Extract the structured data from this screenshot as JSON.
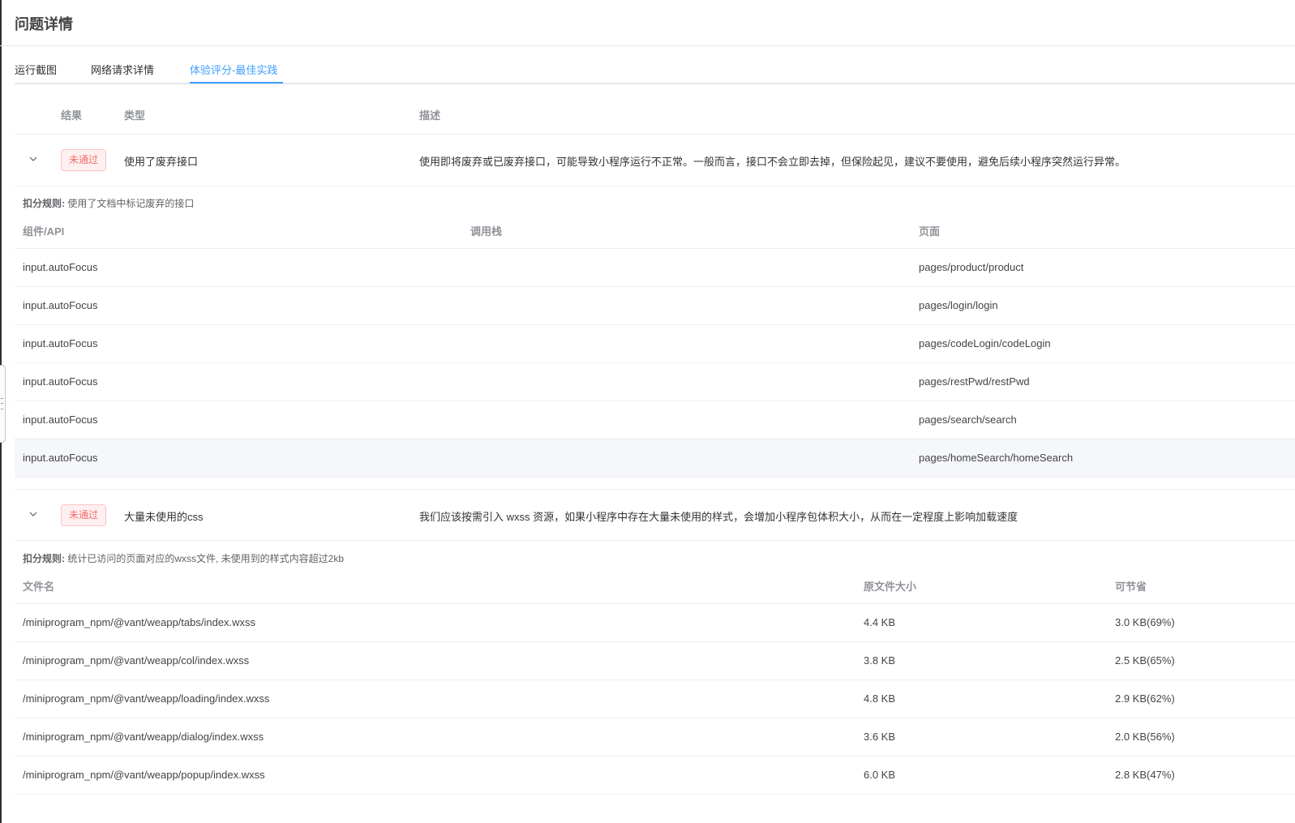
{
  "header": {
    "title": "问题详情"
  },
  "tabs": [
    {
      "label": "运行截图"
    },
    {
      "label": "网络请求详情"
    },
    {
      "label": "体验评分-最佳实践",
      "active": true
    }
  ],
  "accent_color": "#409eff",
  "fail_color": "#f56c6c",
  "main_table": {
    "columns": {
      "result": "结果",
      "type": "类型",
      "description": "描述"
    }
  },
  "issues": [
    {
      "status": "未通过",
      "type": "使用了废弃接口",
      "description": "使用即将废弃或已废弃接口，可能导致小程序运行不正常。一般而言，接口不会立即去掉，但保险起见，建议不要使用，避免后续小程序突然运行异常。",
      "rule_label": "扣分规则:",
      "rule_text": "使用了文档中标记废弃的接口",
      "table": {
        "headers": [
          "组件/API",
          "调用栈",
          "页面"
        ],
        "rows": [
          [
            "input.autoFocus",
            "",
            "pages/product/product"
          ],
          [
            "input.autoFocus",
            "",
            "pages/login/login"
          ],
          [
            "input.autoFocus",
            "",
            "pages/codeLogin/codeLogin"
          ],
          [
            "input.autoFocus",
            "",
            "pages/restPwd/restPwd"
          ],
          [
            "input.autoFocus",
            "",
            "pages/search/search"
          ],
          [
            "input.autoFocus",
            "",
            "pages/homeSearch/homeSearch"
          ]
        ]
      }
    },
    {
      "status": "未通过",
      "type": "大量未使用的css",
      "description": "我们应该按需引入 wxss 资源，如果小程序中存在大量未使用的样式，会增加小程序包体积大小，从而在一定程度上影响加载速度",
      "rule_label": "扣分规则:",
      "rule_text": "统计已访问的页面对应的wxss文件, 未使用到的样式内容超过2kb",
      "table": {
        "headers": [
          "文件名",
          "原文件大小",
          "可节省"
        ],
        "rows": [
          [
            "/miniprogram_npm/@vant/weapp/tabs/index.wxss",
            "4.4 KB",
            "3.0 KB(69%)"
          ],
          [
            "/miniprogram_npm/@vant/weapp/col/index.wxss",
            "3.8 KB",
            "2.5 KB(65%)"
          ],
          [
            "/miniprogram_npm/@vant/weapp/loading/index.wxss",
            "4.8 KB",
            "2.9 KB(62%)"
          ],
          [
            "/miniprogram_npm/@vant/weapp/dialog/index.wxss",
            "3.6 KB",
            "2.0 KB(56%)"
          ],
          [
            "/miniprogram_npm/@vant/weapp/popup/index.wxss",
            "6.0 KB",
            "2.8 KB(47%)"
          ]
        ]
      }
    }
  ]
}
